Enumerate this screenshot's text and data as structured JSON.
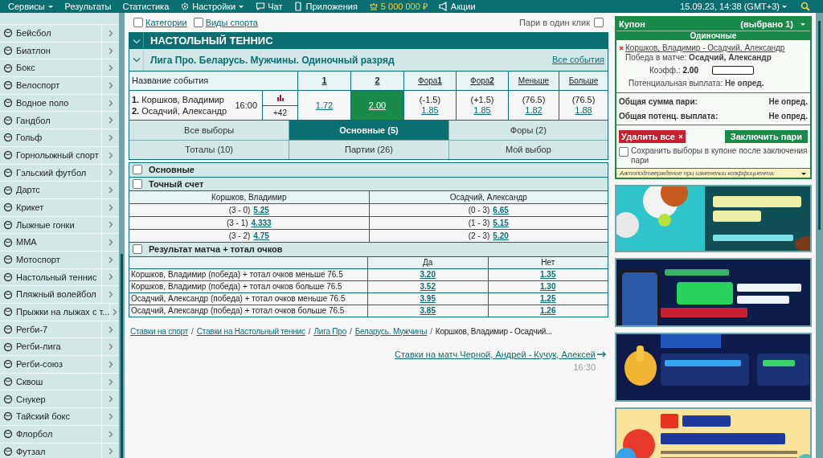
{
  "top_bar": {
    "menu": [
      {
        "label": "Сервисы",
        "has_caret": true,
        "highlight": false
      },
      {
        "label": "Результаты",
        "has_caret": false,
        "highlight": false
      },
      {
        "label": "Статистика",
        "has_caret": false,
        "highlight": false
      },
      {
        "label": "Настройки",
        "has_caret": true,
        "highlight": false
      },
      {
        "label": "Чат",
        "has_caret": false,
        "highlight": false
      },
      {
        "label": "Приложения",
        "has_caret": false,
        "highlight": false
      },
      {
        "label": "5 000 000 ₽",
        "has_caret": false,
        "highlight": true
      },
      {
        "label": "Акции",
        "has_caret": false,
        "highlight": false
      }
    ],
    "datetime": "15.09.23, 14:38 (GMT+3)"
  },
  "sidebar": {
    "items": [
      {
        "label": "Бейсбол"
      },
      {
        "label": "Биатлон"
      },
      {
        "label": "Бокс"
      },
      {
        "label": "Велоспорт"
      },
      {
        "label": "Водное поло"
      },
      {
        "label": "Гандбол"
      },
      {
        "label": "Гольф"
      },
      {
        "label": "Горнолыжный спорт"
      },
      {
        "label": "Гэльский футбол"
      },
      {
        "label": "Дартс"
      },
      {
        "label": "Крикет"
      },
      {
        "label": "Лыжные гонки"
      },
      {
        "label": "MMA"
      },
      {
        "label": "Мотоспорт"
      },
      {
        "label": "Настольный теннис"
      },
      {
        "label": "Пляжный волейбол"
      },
      {
        "label": "Прыжки на лыжах с т..."
      },
      {
        "label": "Регби-7"
      },
      {
        "label": "Регби-лига"
      },
      {
        "label": "Регби-союз"
      },
      {
        "label": "Сквош"
      },
      {
        "label": "Снукер"
      },
      {
        "label": "Тайский бокс"
      },
      {
        "label": "Флорбол"
      },
      {
        "label": "Футзал"
      }
    ]
  },
  "filters": [
    {
      "label": "Категории",
      "checked": false
    },
    {
      "label": "Виды спорта",
      "checked": false
    }
  ],
  "one_click": {
    "label": "Пари в один клик",
    "checked": false
  },
  "sport_title": "НАСТОЛЬНЫЙ ТЕННИС",
  "league": {
    "title": "Лига Про. Беларусь. Мужчины. Одиночный разряд",
    "all_events": "Все события"
  },
  "table": {
    "columns": [
      "Название события",
      "1",
      "2",
      "Фора**1**",
      "Фора**2**",
      "Меньше",
      "Больше"
    ],
    "event": {
      "players": [
        "**1.** Коршков, Владимир",
        "**2.** Осадчий, Александр"
      ],
      "time": "16:00",
      "more": "+42",
      "odds": [
        {
          "odd": "1.72",
          "selected": false
        },
        {
          "odd": "2.00",
          "selected": true
        },
        {
          "line": "(-1.5)",
          "odd": "1.85",
          "selected": false
        },
        {
          "line": "(+1.5)",
          "odd": "1.85",
          "selected": false
        },
        {
          "line": "(76.5)",
          "odd": "1.82",
          "selected": false
        },
        {
          "line": "(76.5)",
          "odd": "1.88",
          "selected": false
        }
      ]
    }
  },
  "tabs": [
    {
      "label": "Все выборы",
      "selected": false
    },
    {
      "label": "Основные (5)",
      "selected": true
    },
    {
      "label": "Форы (2)",
      "selected": false
    },
    {
      "label": "Тоталы (10)",
      "selected": false
    },
    {
      "label": "Партии (26)",
      "selected": false
    },
    {
      "label": "Мой выбор",
      "selected": false
    }
  ],
  "main_group": {
    "title": "Основные",
    "checked": false
  },
  "exact_score": {
    "title": "Точный счет",
    "checked": false,
    "columns": [
      "Коршков, Владимир",
      "Осадчий, Александр"
    ],
    "rows": [
      [
        {
          "score": "(3 - 0)",
          "odd": "5.25"
        },
        {
          "score": "(0 - 3)",
          "odd": "6.65"
        }
      ],
      [
        {
          "score": "(3 - 1)",
          "odd": "4.333"
        },
        {
          "score": "(1 - 3)",
          "odd": "5.15"
        }
      ],
      [
        {
          "score": "(3 - 2)",
          "odd": "4.75"
        },
        {
          "score": "(2 - 3)",
          "odd": "5.20"
        }
      ]
    ]
  },
  "result_total": {
    "title": "Результат матча + тотал очков",
    "checked": false,
    "columns": [
      "Да",
      "Нет"
    ],
    "rows": [
      {
        "label": "Коршков, Владимир (победа) + тотал очков меньше 76.5",
        "values": [
          "3.20",
          "1.35"
        ]
      },
      {
        "label": "Коршков, Владимир (победа) + тотал очков больше 76.5",
        "values": [
          "3.52",
          "1.30"
        ]
      },
      {
        "label": "Осадчий, Александр (победа) + тотал очков меньше 76.5",
        "values": [
          "3.95",
          "1.25"
        ]
      },
      {
        "label": "Осадчий, Александр (победа) + тотал очков больше 76.5",
        "values": [
          "3.85",
          "1.26"
        ]
      }
    ]
  },
  "breadcrumbs": {
    "links": [
      "Ставки на спорт",
      "Ставки на Настольный теннис",
      "Лига Про",
      "Беларусь. Мужчины"
    ],
    "separator": "/",
    "current": "Коршков, Владимир - Осадчий..."
  },
  "next_match": {
    "label": "Ставки на матч Черной, Андрей - Кучук, Алексей",
    "time": "16:30"
  },
  "coupon": {
    "title": "Купон",
    "count": "(выбрано 1)",
    "type": "Одиночные",
    "bet": {
      "match": "Коршков, Владимир - Осадчий, Александр",
      "text": "Победа в матче: **Осадчий, Александр**",
      "coef_label": "Коэфф.:",
      "coef": "2.00",
      "payout": "Потенциальная выплата: **Не опред.**"
    },
    "totals": [
      {
        "label": "Общая сумма пари:",
        "value": "Не опред."
      },
      {
        "label": "Общая потенц. выплата:",
        "value": "Не опред."
      }
    ],
    "delete_all": "Удалить все",
    "place_bet": "Заключить пари",
    "keep": {
      "label": "Сохранить выборы в купоне после заключения пари",
      "checked": false
    },
    "auto_confirm": "Автоподтверждение при изменении коэффициента:"
  }
}
